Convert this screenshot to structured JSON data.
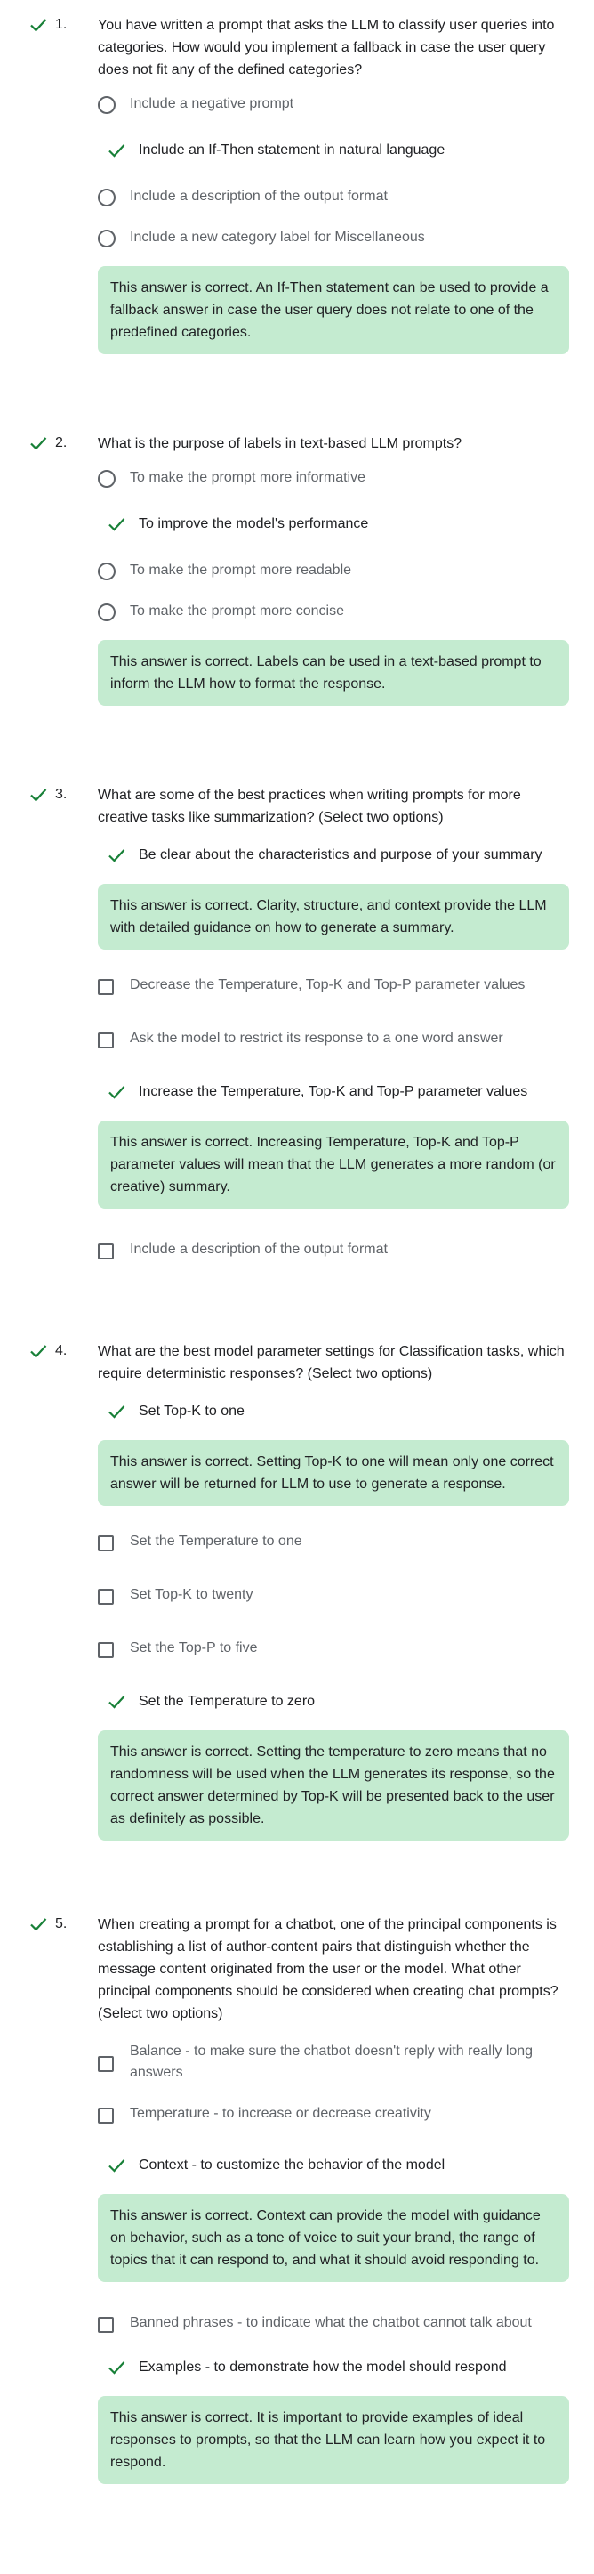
{
  "colors": {
    "correct_green": "#188038",
    "feedback_bg": "#c4ebd0",
    "control_gray": "#5f6368"
  },
  "questions": [
    {
      "number": "1.",
      "status_icon": "check-icon",
      "text": "You have written a prompt that asks the LLM to classify user queries into categories. How would you implement a fallback in case the user query does not fit any of the defined categories?",
      "options": [
        {
          "label": "Include a negative prompt",
          "type": "radio",
          "selected": false
        },
        {
          "label": "Include an If-Then statement in natural language",
          "type": "radio",
          "selected": true
        },
        {
          "label": "Include a description of the output format",
          "type": "radio",
          "selected": false
        },
        {
          "label": "Include a new category label for Miscellaneous",
          "type": "radio",
          "selected": false
        }
      ],
      "feedback": "This answer is correct. An If-Then statement can be used to provide a fallback answer in case the user query does not relate to one of the predefined categories."
    },
    {
      "number": "2.",
      "status_icon": "check-icon",
      "text": "What is the purpose of labels in text-based LLM prompts?",
      "options": [
        {
          "label": "To make the prompt more informative",
          "type": "radio",
          "selected": false
        },
        {
          "label": "To improve the model's performance",
          "type": "radio",
          "selected": true
        },
        {
          "label": "To make the prompt more readable",
          "type": "radio",
          "selected": false
        },
        {
          "label": "To make the prompt more concise",
          "type": "radio",
          "selected": false
        }
      ],
      "feedback": "This answer is correct. Labels can be used in a text-based prompt to inform the LLM how to format the response."
    },
    {
      "number": "3.",
      "status_icon": "check-icon",
      "text": "What are some of the best practices when writing prompts for more creative tasks like summarization? (Select two options)",
      "options": [
        {
          "label": "Be clear about the characteristics and purpose of your summary",
          "type": "checkbox",
          "selected": true,
          "feedback": "This answer is correct. Clarity, structure, and context provide the LLM with detailed guidance on how to generate a summary."
        },
        {
          "label": "Decrease the Temperature, Top-K and Top-P parameter values",
          "type": "checkbox",
          "selected": false
        },
        {
          "label": "Ask the model to restrict its response to a one word answer",
          "type": "checkbox",
          "selected": false
        },
        {
          "label": "Increase the Temperature, Top-K and Top-P parameter values",
          "type": "checkbox",
          "selected": true,
          "feedback": "This answer is correct. Increasing Temperature, Top-K and Top-P parameter values will mean that the LLM generates a more random (or creative) summary."
        },
        {
          "label": "Include a description of the output format",
          "type": "checkbox",
          "selected": false
        }
      ]
    },
    {
      "number": "4.",
      "status_icon": "check-icon",
      "text": "What are the best model parameter settings for Classification tasks, which require deterministic responses? (Select two options)",
      "options": [
        {
          "label": "Set Top-K to one",
          "type": "checkbox",
          "selected": true,
          "feedback": "This answer is correct. Setting Top-K to one will mean only one correct answer will be returned for LLM to use to generate a response."
        },
        {
          "label": "Set the Temperature to one",
          "type": "checkbox",
          "selected": false
        },
        {
          "label": "Set Top-K to twenty",
          "type": "checkbox",
          "selected": false
        },
        {
          "label": "Set the Top-P to five",
          "type": "checkbox",
          "selected": false
        },
        {
          "label": "Set the Temperature to zero",
          "type": "checkbox",
          "selected": true,
          "feedback": "This answer is correct. Setting the temperature to zero means that no randomness will be used when the LLM generates its response, so the correct answer determined by Top-K will be presented back to the user as definitely as possible."
        }
      ]
    },
    {
      "number": "5.",
      "status_icon": "check-icon",
      "text": "When creating a prompt for a chatbot, one of the principal components is establishing a list of author-content pairs that distinguish whether the message content originated from the user or the model. What other principal components should be considered when creating chat prompts? (Select two options)",
      "options": [
        {
          "label": "Balance - to make sure the chatbot doesn't reply with really long answers",
          "type": "checkbox",
          "selected": false
        },
        {
          "label": "Temperature - to increase or decrease creativity",
          "type": "checkbox",
          "selected": false
        },
        {
          "label": "Context - to customize the behavior of the model",
          "type": "checkbox",
          "selected": true,
          "feedback": "This answer is correct. Context can provide the model with guidance on behavior, such as a tone of voice to suit your brand, the range of topics that it can respond to, and what it should avoid responding to."
        },
        {
          "label": "Banned phrases - to indicate what the chatbot cannot talk about",
          "type": "checkbox",
          "selected": false
        },
        {
          "label": "Examples - to demonstrate how the model should respond",
          "type": "checkbox",
          "selected": true,
          "feedback": "This answer is correct. It is important to provide examples of ideal responses to prompts, so that the LLM can learn how you expect it to respond."
        }
      ]
    }
  ]
}
